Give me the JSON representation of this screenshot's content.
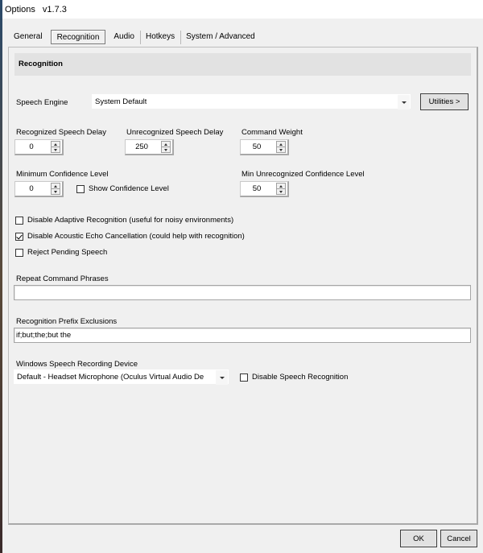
{
  "window": {
    "title": "Options",
    "version": "v1.7.3"
  },
  "tabs": [
    {
      "label": "General",
      "active": false
    },
    {
      "label": "Recognition",
      "active": true
    },
    {
      "label": "Audio",
      "active": false
    },
    {
      "label": "Hotkeys",
      "active": false
    },
    {
      "label": "System / Advanced",
      "active": false
    }
  ],
  "section": {
    "title": "Recognition"
  },
  "speech_engine": {
    "label": "Speech Engine",
    "value": "System Default",
    "utilities_button": "Utilities >"
  },
  "spinners": {
    "recognized_speech_delay": {
      "label": "Recognized Speech Delay",
      "value": "0"
    },
    "unrecognized_speech_delay": {
      "label": "Unrecognized Speech Delay",
      "value": "250"
    },
    "command_weight": {
      "label": "Command Weight",
      "value": "50"
    },
    "minimum_confidence_level": {
      "label": "Minimum Confidence Level",
      "value": "0"
    },
    "min_unrecognized_confidence_level": {
      "label": "Min Unrecognized Confidence Level",
      "value": "50"
    }
  },
  "checkboxes": {
    "show_confidence_level": {
      "label": "Show Confidence Level",
      "checked": false
    },
    "disable_adaptive_recognition": {
      "label": "Disable Adaptive Recognition (useful for noisy environments)",
      "checked": false
    },
    "disable_acoustic_echo_cancellation": {
      "label": "Disable Acoustic Echo Cancellation (could help with recognition)",
      "checked": true
    },
    "reject_pending_speech": {
      "label": "Reject Pending Speech",
      "checked": false
    },
    "disable_speech_recognition": {
      "label": "Disable Speech Recognition",
      "checked": false
    }
  },
  "repeat_command_phrases": {
    "label": "Repeat Command Phrases",
    "value": ""
  },
  "recognition_prefix_exclusions": {
    "label": "Recognition Prefix Exclusions",
    "value": "if;but;the;but the"
  },
  "recording_device": {
    "label": "Windows Speech Recording Device",
    "value": "Default - Headset Microphone (Oculus Virtual Audio De"
  },
  "footer": {
    "ok_label": "OK",
    "cancel_label": "Cancel"
  }
}
